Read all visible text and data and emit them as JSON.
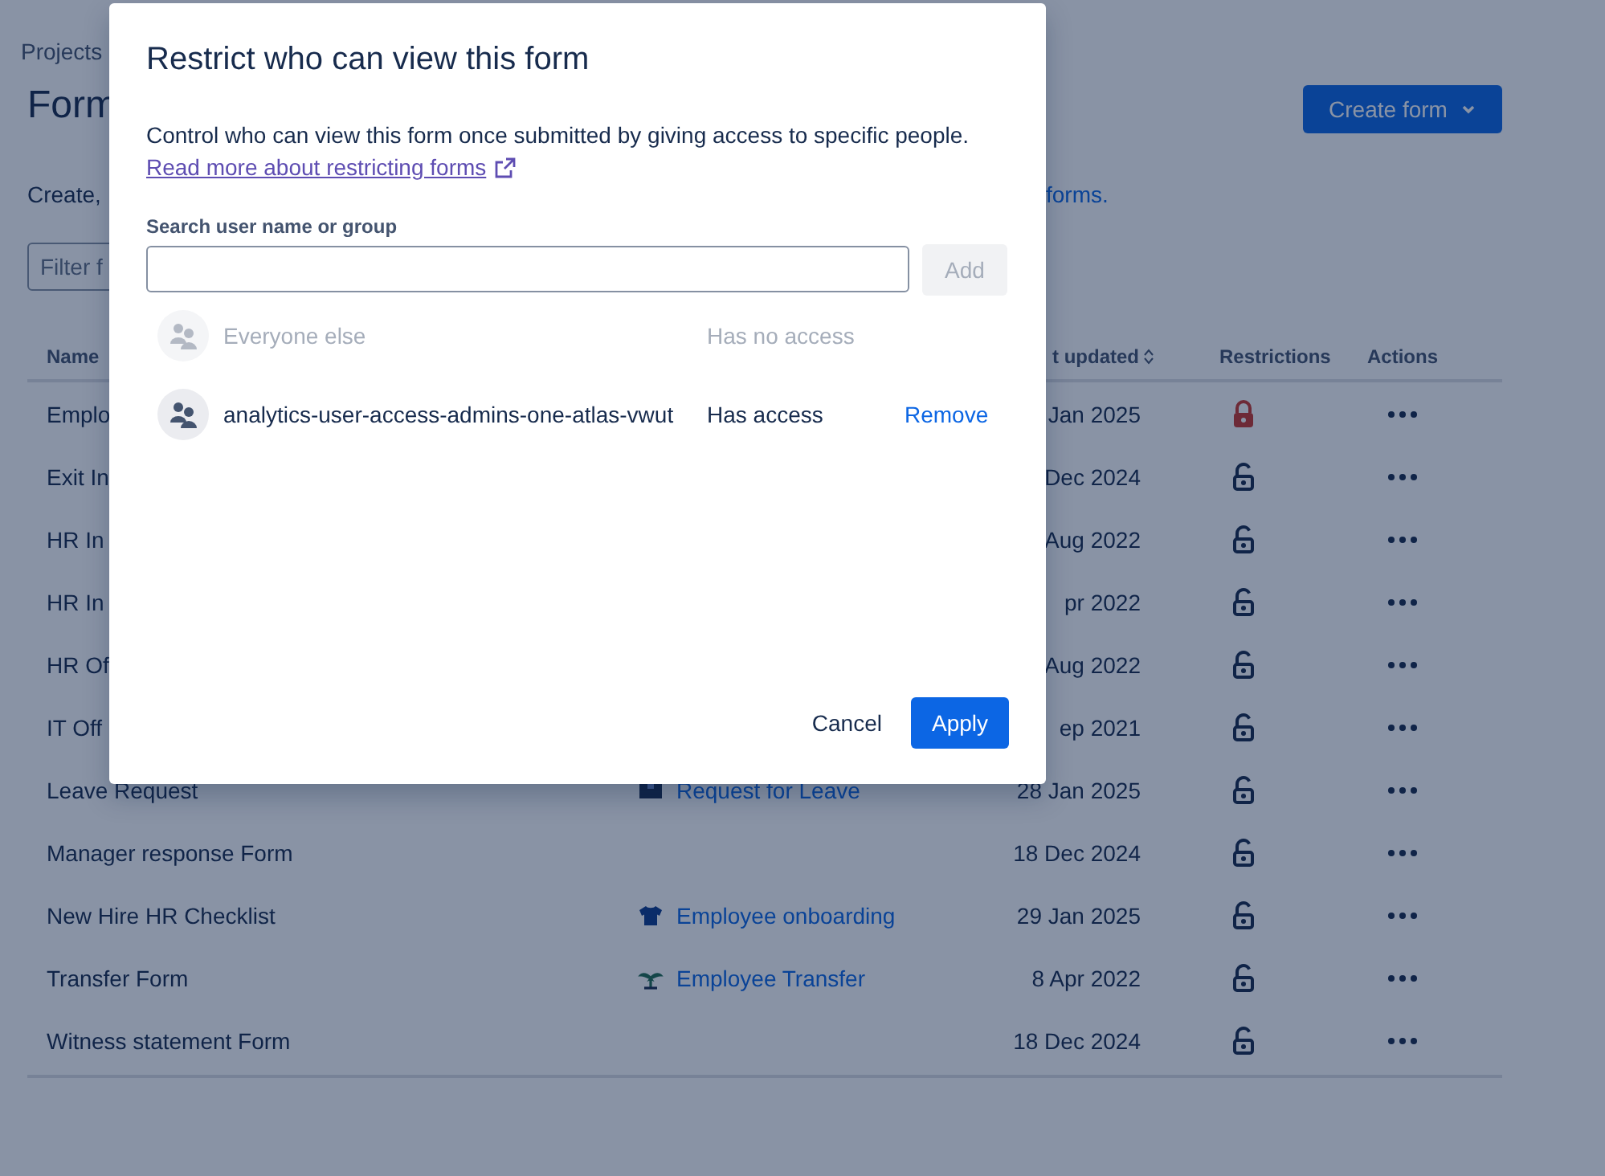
{
  "page": {
    "breadcrumb": "Projects",
    "title": "Form",
    "description_start": "Create, ",
    "description_link": "forms.",
    "filter_placeholder": "Filter f",
    "create_button": "Create form"
  },
  "table": {
    "columns": [
      "Name",
      "t updated",
      "Restrictions",
      "Actions"
    ],
    "rows": [
      {
        "name": "Emplo",
        "date": "Jan 2025",
        "restricted": true
      },
      {
        "name": "Exit In",
        "date": "Dec 2024",
        "restricted": false
      },
      {
        "name": "HR In",
        "date": "Aug 2022",
        "restricted": false
      },
      {
        "name": "HR In",
        "date": "pr 2022",
        "restricted": false
      },
      {
        "name": "HR Of",
        "date": "Aug 2022",
        "restricted": false
      },
      {
        "name": "IT Off",
        "date": "ep 2021",
        "restricted": false
      },
      {
        "name": "Leave Request",
        "request_type": "Request for Leave",
        "date": "28 Jan 2025",
        "restricted": false
      },
      {
        "name": "Manager response Form",
        "date": "18 Dec 2024",
        "restricted": false
      },
      {
        "name": "New Hire HR Checklist",
        "request_type": "Employee onboarding",
        "date": "29 Jan 2025",
        "restricted": false
      },
      {
        "name": "Transfer Form",
        "request_type": "Employee Transfer",
        "date": "8 Apr 2022",
        "restricted": false
      },
      {
        "name": "Witness statement Form",
        "date": "18 Dec 2024",
        "restricted": false
      }
    ]
  },
  "dialog": {
    "title": "Restrict who can view this form",
    "description": "Control who can view this form once submitted by giving access to specific people.",
    "link": "Read more about restricting forms",
    "search_label": "Search user name or group",
    "add_button": {
      "label": "Add",
      "disabled": true
    },
    "entries": [
      {
        "name": "Everyone else",
        "access": "Has no access",
        "disabled": true
      },
      {
        "name": "analytics-user-access-admins-one-atlas-vwut",
        "access": "Has access",
        "disabled": false,
        "action": "Remove"
      }
    ],
    "buttons": [
      "Cancel",
      "Apply"
    ]
  }
}
